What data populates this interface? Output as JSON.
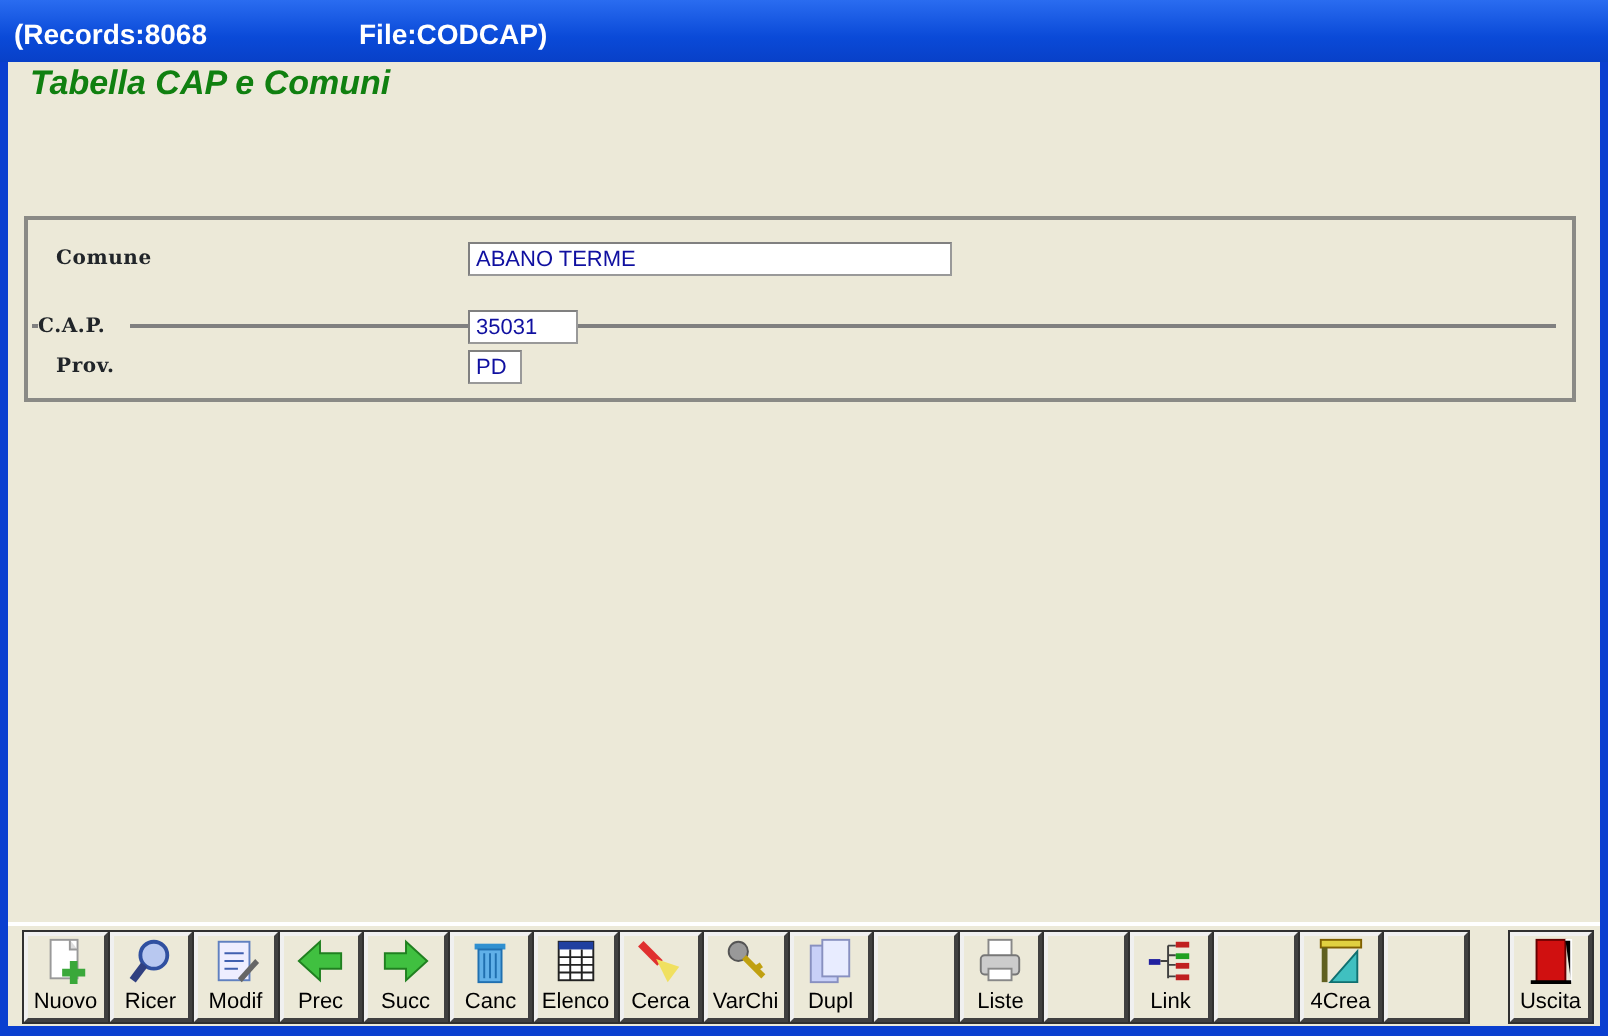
{
  "window": {
    "title_records": "(Records:8068",
    "title_file": "File:CODCAP)"
  },
  "heading": "Tabella CAP e Comuni",
  "fields": [
    {
      "label": "Comune",
      "value": "ABANO TERME",
      "kind": "wide"
    },
    {
      "label": "C.A.P.",
      "value": "35031",
      "kind": "ruled"
    },
    {
      "label": "Prov.",
      "value": "PD",
      "kind": "short"
    }
  ],
  "toolbar": [
    {
      "label": "Nuovo",
      "kind": "new"
    },
    {
      "label": "Ricer",
      "kind": "magnifier"
    },
    {
      "label": "Modif",
      "kind": "edit"
    },
    {
      "label": "Prec",
      "kind": "left"
    },
    {
      "label": "Succ",
      "kind": "right"
    },
    {
      "label": "Canc",
      "kind": "trash"
    },
    {
      "label": "Elenco",
      "kind": "table"
    },
    {
      "label": "Cerca",
      "kind": "flashlight"
    },
    {
      "label": "VarChi",
      "kind": "keys"
    },
    {
      "label": "Dupl",
      "kind": "copy"
    },
    {
      "kind": "blank"
    },
    {
      "label": "Liste",
      "kind": "printer"
    },
    {
      "kind": "blank"
    },
    {
      "label": "Link",
      "kind": "tree"
    },
    {
      "kind": "blank"
    },
    {
      "label": "4Crea",
      "kind": "ruler"
    },
    {
      "kind": "blank"
    },
    {
      "label": "Uscita",
      "kind": "door",
      "separate": true
    }
  ]
}
